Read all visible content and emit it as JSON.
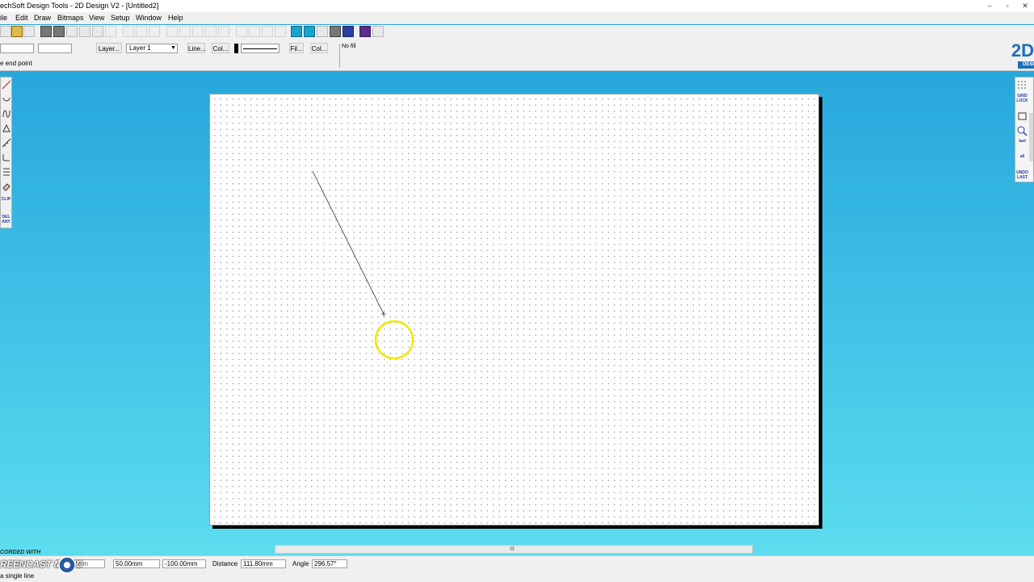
{
  "window": {
    "title": "echSoft Design Tools - 2D Design V2 - [Untitled2]",
    "controls": [
      "–",
      "▫",
      "✕"
    ]
  },
  "menu": [
    "ile",
    "Edit",
    "Draw",
    "Bitmaps",
    "View",
    "Setup",
    "Window",
    "Help"
  ],
  "toolbar": {
    "layer_button": "Layer...",
    "layer_select": "Layer 1",
    "line_button": "Line...",
    "line_col_button": "Col...",
    "fill_button": "Fil...",
    "fill_col_button": "Col...",
    "fill_value": "No fill"
  },
  "hint": "e end point",
  "logo_text": "2D",
  "logo_sub": "DESI",
  "right_tools": {
    "grid_lock": "GRID LOCK",
    "last": "last",
    "all": "all",
    "undo_last": "UNDO LAST"
  },
  "left_tools": {
    "clip": "CLIP",
    "del_any": "DEL ANY"
  },
  "status": {
    "x_field": "-50.00mm",
    "y_field": "50.00mm",
    "z_field": "-100.00mm",
    "distance_label": "Distance",
    "distance_value": "111.80mm",
    "angle_label": "Angle",
    "angle_value": "296.57°",
    "hint": "a single line"
  },
  "watermark": {
    "recorded": "CORDED WITH",
    "brand": "REENCAST MATIC"
  },
  "scroll_grip": "III",
  "colors": {
    "background_top": "#1f9fd8",
    "background_bottom": "#5fe0f0",
    "cursor_halo": "#f2e600",
    "line": "#333333"
  }
}
